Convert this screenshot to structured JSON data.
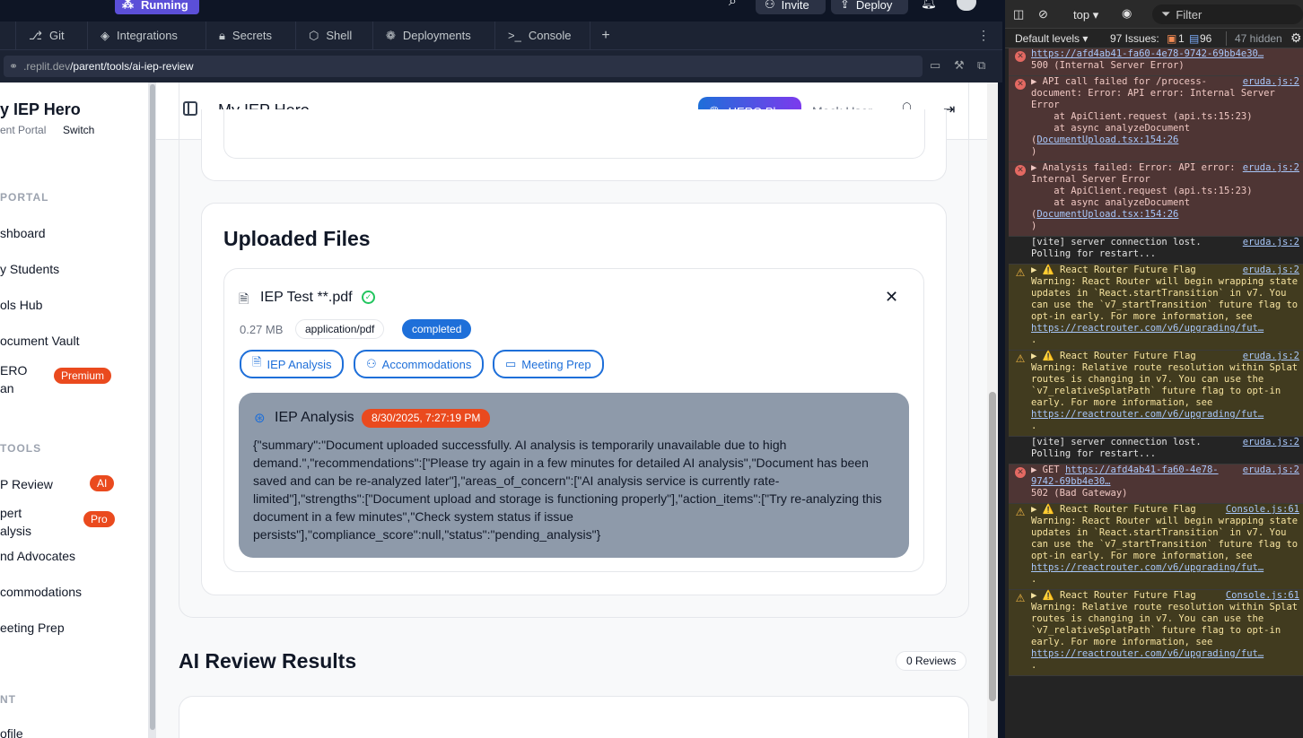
{
  "topbar": {
    "run_label": "Running",
    "invite_label": "Invite",
    "deploy_label": "Deploy"
  },
  "tabs": [
    {
      "icon": "git-icon",
      "label": "Git"
    },
    {
      "icon": "integrations-icon",
      "label": "Integrations"
    },
    {
      "icon": "lock-icon",
      "label": "Secrets"
    },
    {
      "icon": "shell-icon",
      "label": "Shell"
    },
    {
      "icon": "deployments-icon",
      "label": "Deployments"
    },
    {
      "icon": "console-icon",
      "label": "Console"
    }
  ],
  "url": {
    "prefix": ".replit.dev",
    "path": "/parent/tools/ai-iep-review"
  },
  "sidebar": {
    "title": "y IEP Hero",
    "portal_label": "ent Portal",
    "switch_label": "Switch",
    "section_portal": "PORTAL",
    "items_portal": [
      {
        "label": "shboard"
      },
      {
        "label": "y Students"
      },
      {
        "label": "ols Hub"
      },
      {
        "label": "ocument Vault"
      }
    ],
    "hero_plan_l1": "ERO",
    "hero_plan_l2": "an",
    "premium_badge": "Premium",
    "section_tools": "TOOLS",
    "review_label": "P Review",
    "ai_badge": "AI",
    "expert_l1": "pert",
    "expert_l2": "alysis",
    "pro_badge": "Pro",
    "advocates_label": "nd Advocates",
    "accommodations_label": "commodations",
    "meeting_label": "eeting Prep",
    "section_account": "NT",
    "profile_label": "ofile"
  },
  "header": {
    "title": "My IEP Hero",
    "plan_label": "HERO Plan",
    "user_label": "Mock User"
  },
  "uploaded": {
    "title": "Uploaded Files",
    "file_name": "IEP Test **.pdf",
    "size": "0.27 MB",
    "mime": "application/pdf",
    "status": "completed",
    "actions": [
      "IEP Analysis",
      "Accommodations",
      "Meeting Prep"
    ],
    "analysis_title": "IEP Analysis",
    "analysis_time": "8/30/2025, 7:27:19 PM",
    "analysis_body": "{\"summary\":\"Document uploaded successfully. AI analysis is temporarily unavailable due to high demand.\",\"recommendations\":[\"Please try again in a few minutes for detailed AI analysis\",\"Document has been saved and can be re-analyzed later\"],\"areas_of_concern\":[\"AI analysis service is currently rate-limited\"],\"strengths\":[\"Document upload and storage is functioning properly\"],\"action_items\":[\"Try re-analyzing this document in a few minutes\",\"Check system status if issue persists\"],\"compliance_score\":null,\"status\":\"pending_analysis\"}"
  },
  "results": {
    "title": "AI Review Results",
    "count": "0 Reviews"
  },
  "devtools": {
    "context": "top",
    "filter_placeholder": "Filter",
    "levels": "Default levels",
    "issues_label": "97 Issues:",
    "issues_err": "1",
    "issues_info": "96",
    "hidden": "47 hidden"
  },
  "console": [
    {
      "type": "err",
      "src": "",
      "text": "",
      "link": "https://afd4ab41-fa60-4e78-9742-69bb4e30…",
      "tail": "500 (Internal Server Error)"
    },
    {
      "type": "err",
      "src": "eruda.js:2",
      "text": "▶ API call failed for /process-document: Error: API error: Internal Server Error\n    at ApiClient.request (api.ts:15:23)\n    at async analyzeDocument (",
      "link": "DocumentUpload.tsx:154:26",
      "tail": ")"
    },
    {
      "type": "err",
      "src": "eruda.js:2",
      "text": "▶ Analysis failed: Error: API error: Internal Server Error\n    at ApiClient.request (api.ts:15:23)\n    at async analyzeDocument (",
      "link": "DocumentUpload.tsx:154:26",
      "tail": ")"
    },
    {
      "type": "log",
      "src": "eruda.js:2",
      "text": "[vite] server connection lost. Polling for restart...",
      "link": "",
      "tail": ""
    },
    {
      "type": "warn",
      "src": "eruda.js:2",
      "text": "▶ ⚠️ React Router Future Flag Warning: React Router will begin wrapping state updates in `React.startTransition` in v7. You can use the `v7_startTransition` future flag to opt-in early. For more information, see ",
      "link": "https://reactrouter.com/v6/upgrading/fut…",
      "tail": "."
    },
    {
      "type": "warn",
      "src": "eruda.js:2",
      "text": "▶ ⚠️ React Router Future Flag Warning: Relative route resolution within Splat routes is changing in v7. You can use the `v7_relativeSplatPath` future flag to opt-in early. For more information, see ",
      "link": "https://reactrouter.com/v6/upgrading/fut…",
      "tail": "."
    },
    {
      "type": "log",
      "src": "eruda.js:2",
      "text": "[vite] server connection lost. Polling for restart...",
      "link": "",
      "tail": ""
    },
    {
      "type": "err",
      "src": "eruda.js:2",
      "text": "▶ GET ",
      "link": "https://afd4ab41-fa60-4e78-9742-69bb4e30…",
      "tail": "502 (Bad Gateway)"
    },
    {
      "type": "warn",
      "src": "Console.js:61",
      "text": "▶ ⚠️ React Router Future Flag Warning: React Router will begin wrapping state updates in `React.startTransition` in v7. You can use the `v7_startTransition` future flag to opt-in early. For more information, see ",
      "link": "https://reactrouter.com/v6/upgrading/fut…",
      "tail": "."
    },
    {
      "type": "warn",
      "src": "Console.js:61",
      "text": "▶ ⚠️ React Router Future Flag Warning: Relative route resolution within Splat routes is changing in v7. You can use the `v7_relativeSplatPath` future flag to opt-in early. For more information, see ",
      "link": "https://reactrouter.com/v6/upgrading/fut…",
      "tail": "."
    }
  ]
}
